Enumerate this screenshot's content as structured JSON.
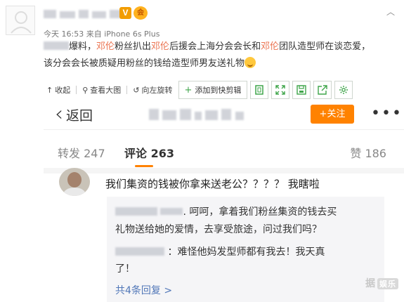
{
  "post": {
    "vip_badge_text": "V",
    "vip_level_text": "会",
    "caret": "︿",
    "meta": "今天 16:53 来自 iPhone 6s Plus",
    "line1": [
      {
        "text": "爆料，",
        "hl": false
      },
      {
        "text": "邓伦",
        "hl": true
      },
      {
        "text": "粉丝扒出",
        "hl": false
      },
      {
        "text": "邓伦",
        "hl": true
      },
      {
        "text": "后援会上海分会会长和",
        "hl": false
      },
      {
        "text": "邓伦",
        "hl": true
      },
      {
        "text": "团队造型师在谈恋爱，",
        "hl": false
      }
    ],
    "line2": "该分会会长被质疑用粉丝的钱给造型师男友送礼物"
  },
  "toolbar": {
    "collapse": "收起",
    "view_large": "查看大图",
    "rotate_left": "向左旋转",
    "add_clip_plus": "+",
    "add_clip": "添加到快剪辑"
  },
  "screenshot": {
    "back_label": "返回",
    "follow_label": "+关注",
    "more_dots": "•••",
    "tabs": {
      "repost": "转发 247",
      "comment": "评论 263",
      "like": "赞 186"
    },
    "comment_text": "我们集资的钱被你拿来送老公？？？？ 我瞎啦",
    "replies": {
      "line1": ". 呵呵，拿着我们粉丝集资的钱去买",
      "line2": "礼物送给她的爱情，去享受旅途，问过我们吗？",
      "line3": "：难怪他妈发型师都有我去！我天真",
      "line4": "了！"
    },
    "more_replies": "共4条回复 >",
    "watermark": "据",
    "watermark_tag": "娱乐"
  },
  "colors": {
    "highlight": "#eb7350",
    "follow": "#ff8200",
    "link": "#5177b8",
    "toolbar_green": "#3fa54a"
  }
}
